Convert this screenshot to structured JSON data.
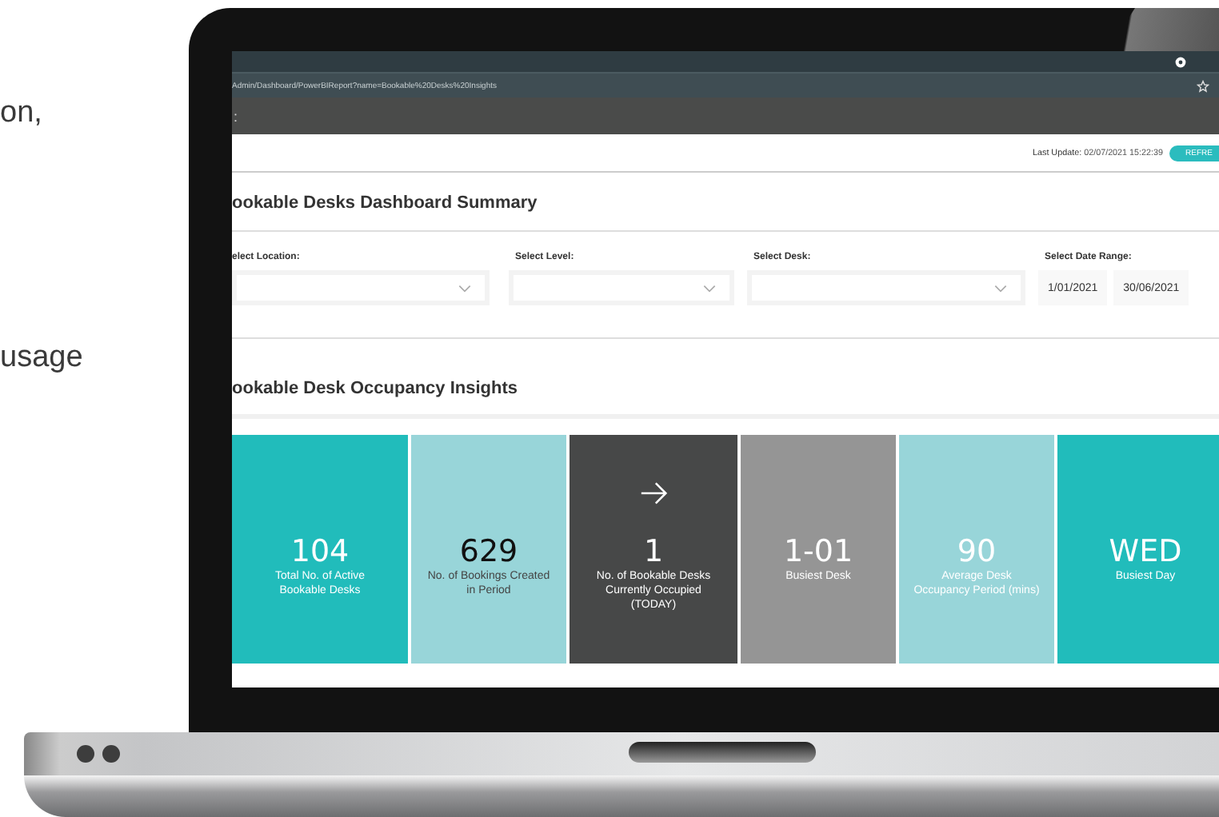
{
  "side_text": [
    "on,",
    "usage"
  ],
  "browser": {
    "url": "Admin/Dashboard/PowerBIReport?name=Bookable%20Desks%20Insights",
    "toolbar_mark": ":"
  },
  "header": {
    "last_update_label": "Last Update:",
    "last_update": "02/07/2021 15:22:39",
    "refresh_button": "REFRE"
  },
  "summary_title": "ookable Desks Dashboard Summary",
  "filters": [
    {
      "label": "elect Location:",
      "kind": "dropdown"
    },
    {
      "label": "Select Level:",
      "kind": "dropdown"
    },
    {
      "label": "Select Desk:",
      "kind": "dropdown"
    },
    {
      "label": "Select Date Range:",
      "kind": "date-range",
      "start": "1/01/2021",
      "end": "30/06/2021"
    }
  ],
  "insights_title": "ookable Desk Occupancy Insights",
  "tiles": [
    {
      "value": "104",
      "label": "Total No. of Active Bookable Desks",
      "color": "#21bcbb",
      "kind": "light-text",
      "arrow": false
    },
    {
      "value": "629",
      "label": "No. of Bookings Created in Period",
      "color": "#98d5d9",
      "kind": "dark-text",
      "arrow": false
    },
    {
      "value": "1",
      "label": "No. of Bookable Desks Currently Occupied (TODAY)",
      "color": "#474848",
      "kind": "light-text",
      "arrow": true
    },
    {
      "value": "1-01",
      "label": "Busiest Desk",
      "color": "#959595",
      "kind": "light-text",
      "arrow": false
    },
    {
      "value": "90",
      "label": "Average Desk Occupancy Period (mins)",
      "color": "#98d5d9",
      "kind": "light-text",
      "arrow": false
    },
    {
      "value": "WED",
      "label": "Busiest Day",
      "color": "#21bcbb",
      "kind": "light-text",
      "arrow": false
    }
  ]
}
